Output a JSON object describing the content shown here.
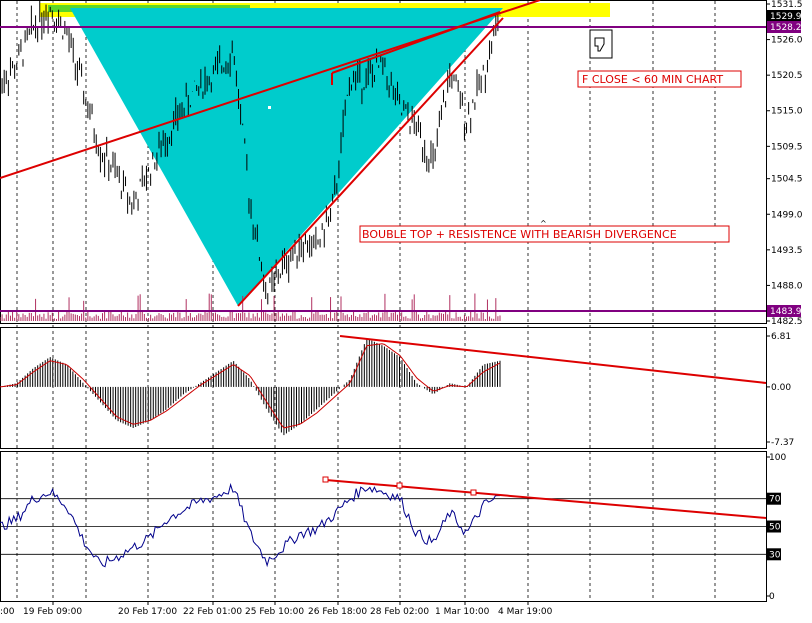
{
  "chart_data": [
    {
      "type": "line",
      "panel": "price",
      "title": "",
      "xlabel": "",
      "ylabel": "",
      "ylim": [
        1482.5,
        1531.5
      ],
      "y_ticks": [
        "1531.5",
        "1526.0",
        "1520.5",
        "1515.0",
        "1509.5",
        "1504.5",
        "1499.0",
        "1493.5",
        "1488.0",
        "1482.5"
      ],
      "x_ticks": [
        "19 Feb 09:00",
        "20 Feb 17:00",
        "22 Feb 01:00",
        "25 Feb 10:00",
        "26 Feb 18:00",
        "28 Feb 02:00",
        "1 Mar 10:00",
        "4 Mar 19:00"
      ],
      "x_tick_left_fragment": ":00",
      "series": [
        {
          "values": [
            1519.5,
            1522.0,
            1528.0,
            1531.0,
            1527.0,
            1518.0,
            1509.0,
            1505.0,
            1500.5,
            1506.0,
            1511.0,
            1515.5,
            1519.0,
            1521.0,
            1524.5,
            1501.0,
            1486.5,
            1491.0,
            1494.5,
            1494.0,
            1500.0,
            1520.0,
            1520.0,
            1522.0,
            1515.0,
            1512.5,
            1506.5,
            1521.0,
            1513.5,
            1520.5,
            1530.0
          ]
        }
      ],
      "price_labels": [
        "1529.9",
        "1528.2",
        "1483.9"
      ],
      "horizontal_lines": [
        1528.2,
        1483.9
      ],
      "annotations": [
        "F CLOSE < 60 MIN CHART",
        "BOUBLE TOP + RESISTENCE WITH BEARISH DIVERGENCE"
      ],
      "colors": {
        "candles": "#000000",
        "trendline": "#dd0000",
        "level_line": "#800080",
        "triangle": "#00cccc",
        "zone": "#ffff00",
        "zone_green": "#33cc33",
        "level_label_bg": "#800080"
      }
    },
    {
      "type": "bar",
      "panel": "macd",
      "ylim": [
        -7.37,
        6.81
      ],
      "y_ticks": [
        "6.81",
        "0.00",
        "-7.37"
      ],
      "histogram": [
        0,
        0.5,
        2.5,
        4.0,
        3.0,
        0.5,
        -2.0,
        -4.5,
        -5.5,
        -4.5,
        -3.0,
        -1.0,
        0.5,
        2.0,
        3.5,
        1.0,
        -3.0,
        -6.5,
        -5.0,
        -3.0,
        -1.0,
        1.0,
        6.5,
        5.5,
        4.0,
        0.5,
        -1.0,
        0.5,
        0.0,
        3.0,
        3.5
      ],
      "signal": [
        0,
        0.3,
        2.0,
        3.5,
        3.0,
        1.0,
        -1.5,
        -4.0,
        -5.0,
        -4.5,
        -3.2,
        -1.5,
        0.2,
        1.6,
        3.0,
        1.5,
        -2.0,
        -5.5,
        -5.0,
        -3.5,
        -1.5,
        0.5,
        5.5,
        5.8,
        4.2,
        1.2,
        -0.6,
        0.2,
        0.0,
        2.0,
        3.2
      ],
      "colors": {
        "histogram": "#000000",
        "signal": "#cc0000",
        "trendline": "#dd0000"
      }
    },
    {
      "type": "line",
      "panel": "rsi",
      "ylim": [
        0,
        100
      ],
      "y_ticks": [
        "100",
        "70",
        "50",
        "30",
        "0"
      ],
      "levels": [
        70,
        50,
        30
      ],
      "series": [
        {
          "values": [
            50,
            55,
            70,
            75,
            65,
            40,
            22,
            28,
            35,
            42,
            55,
            62,
            68,
            72,
            78,
            45,
            25,
            35,
            45,
            48,
            58,
            70,
            79,
            75,
            70,
            45,
            38,
            60,
            45,
            65,
            72
          ]
        }
      ],
      "colors": {
        "line": "#00008b",
        "trendline": "#dd0000",
        "level_label_bg": "#000000"
      }
    }
  ]
}
